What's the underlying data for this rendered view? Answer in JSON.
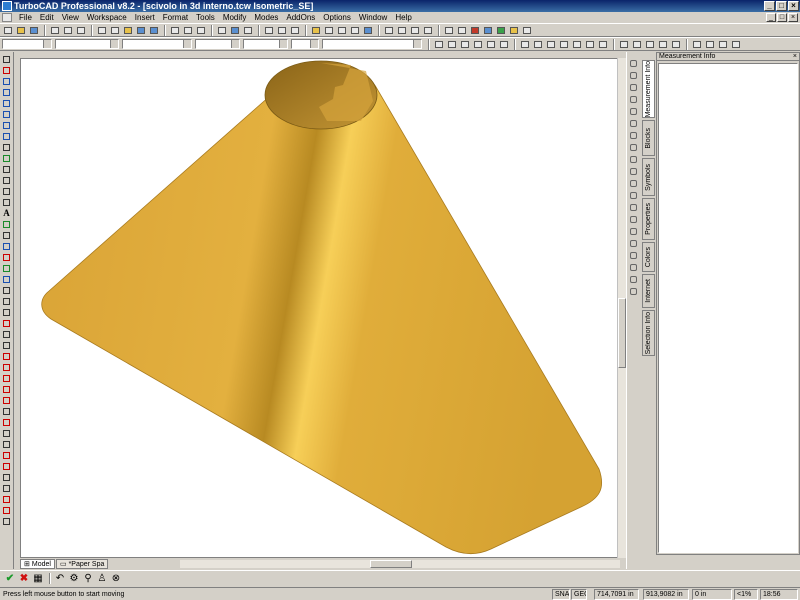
{
  "window": {
    "title": "TurboCAD Professional v8.2 - [scivolo in 3d interno.tcw Isometric_SE]",
    "minimize": "_",
    "maximize": "□",
    "close": "×"
  },
  "menu": {
    "items": [
      "File",
      "Edit",
      "View",
      "Workspace",
      "Insert",
      "Format",
      "Tools",
      "Modify",
      "Modes",
      "AddOns",
      "Options",
      "Window",
      "Help"
    ]
  },
  "side_tabs": {
    "measurement_info": "Measurement Info",
    "blocks": "Blocks",
    "symbols": "Symbols",
    "properties": "Properties",
    "colors": "Colors",
    "internet": "Internet",
    "selection_info": "Selection Info"
  },
  "panel": {
    "title": "Measurement Info",
    "close": "×"
  },
  "sheet_tabs": [
    {
      "label": "Model"
    },
    {
      "label": "*Paper Spa"
    }
  ],
  "status": {
    "message": "Press left mouse button to start moving",
    "snap": "SNAP",
    "geo": "GEO",
    "x_value": "714,7091 in",
    "y_value": "913,9082 in",
    "z_value": "0 in",
    "zoom": "<1%",
    "time": "18:56"
  },
  "colors": {
    "solid_main": "#e0ad3a",
    "solid_dark": "#b88a22",
    "solid_light": "#f7cf58",
    "title_bar": "#0a246a"
  },
  "icons": {
    "toolbar": [
      "new-icon",
      "open-icon",
      "save-icon",
      "print-icon",
      "cut-icon",
      "copy-icon",
      "paste-icon",
      "undo-icon",
      "redo-icon",
      "zoom-in-icon",
      "zoom-out-icon"
    ],
    "left_palette": [
      "select-arrow-icon",
      "line-icon",
      "polyline-icon",
      "arc-icon",
      "circle-icon",
      "rectangle-icon",
      "text-icon",
      "hatch-icon",
      "dimension-icon",
      "3d-object-icon"
    ]
  }
}
